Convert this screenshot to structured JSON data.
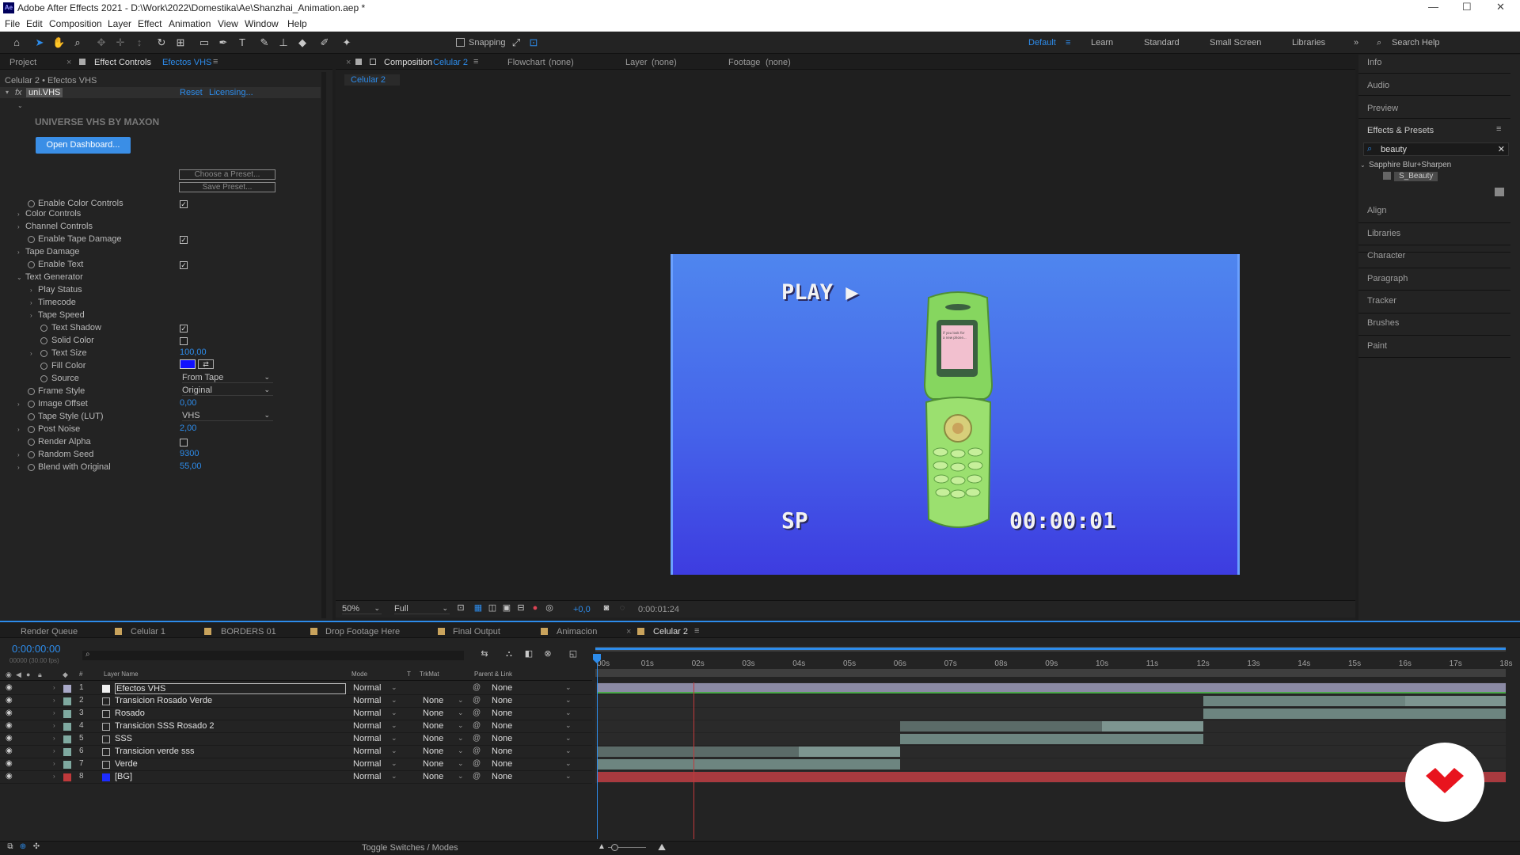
{
  "app": {
    "title": "Adobe After Effects 2021 - D:\\Work\\2022\\Domestika\\Ae\\Shanzhai_Animation.aep *",
    "logo": "Ae",
    "window_controls": [
      "—",
      "☐",
      "✕"
    ]
  },
  "menu": [
    "File",
    "Edit",
    "Composition",
    "Layer",
    "Effect",
    "Animation",
    "View",
    "Window",
    "Help"
  ],
  "toolbar": {
    "snapping_label": "Snapping",
    "workspaces": [
      "Default",
      "Learn",
      "Standard",
      "Small Screen",
      "Libraries"
    ],
    "active_workspace": "Default",
    "search_placeholder": "Search Help"
  },
  "left_panel": {
    "tab_project": "Project",
    "tab_effect_controls": "Effect Controls",
    "tab_effect_controls_target": "Efectos VHS",
    "breadcrumb": "Celular 2 • Efectos VHS",
    "fx_badge": "fx",
    "effect_name": "uni.VHS",
    "reset_label": "Reset",
    "licensing_label": "Licensing...",
    "plugin_title": "UNIVERSE VHS BY MAXON",
    "dashboard_button": "Open Dashboard...",
    "choose_preset": "Choose a Preset...",
    "save_preset": "Save Preset...",
    "properties": [
      {
        "label": "Enable Color Controls",
        "checkbox": true,
        "checked": true
      },
      {
        "label": "Color Controls",
        "group": true
      },
      {
        "label": "Channel Controls",
        "group": true
      },
      {
        "label": "Enable Tape Damage",
        "checkbox": true,
        "checked": true
      },
      {
        "label": "Tape Damage",
        "group": true
      },
      {
        "label": "Enable Text",
        "checkbox": true,
        "checked": true
      },
      {
        "label": "Text Generator",
        "group": true,
        "expanded": true
      },
      {
        "label": "Play Status",
        "group": true,
        "indent": 1
      },
      {
        "label": "Timecode",
        "group": true,
        "indent": 1
      },
      {
        "label": "Tape Speed",
        "group": true,
        "indent": 1
      },
      {
        "label": "Text Shadow",
        "checkbox": true,
        "checked": true,
        "indent": 1
      },
      {
        "label": "Solid Color",
        "checkbox": true,
        "checked": false,
        "indent": 1
      },
      {
        "label": "Text Size",
        "value": "100,00",
        "indent": 1
      },
      {
        "label": "Fill Color",
        "color": "#1010ff",
        "indent": 1
      },
      {
        "label": "Source",
        "dropdown": "From Tape",
        "indent": 1
      },
      {
        "label": "Frame Style",
        "dropdown": "Original"
      },
      {
        "label": "Image Offset",
        "value": "0,00"
      },
      {
        "label": "Tape Style (LUT)",
        "dropdown": "VHS"
      },
      {
        "label": "Post Noise",
        "value": "2,00"
      },
      {
        "label": "Render Alpha",
        "checkbox": true,
        "checked": false
      },
      {
        "label": "Random Seed",
        "value": "9300"
      },
      {
        "label": "Blend with Original",
        "value": "55,00"
      }
    ]
  },
  "viewer": {
    "tab_composition": "Composition",
    "tab_composition_target": "Celular 2",
    "tab_flowchart": "Flowchart",
    "tab_flowchart_target": "(none)",
    "tab_layer": "Layer",
    "tab_layer_target": "(none)",
    "tab_footage": "Footage",
    "tab_footage_target": "(none)",
    "comp_subtab": "Celular 2",
    "overlay_play": "PLAY ▶",
    "overlay_sp": "SP",
    "overlay_timecode": "00:00:01",
    "phone_screen_text": "if you look for a new phone, you'll love something that happens...",
    "zoom": "50%",
    "resolution": "Full",
    "exposure": "+0,0",
    "current_time": "0:00:01:24"
  },
  "right_panel": {
    "items_top": [
      "Info",
      "Audio",
      "Preview"
    ],
    "effects_presets_title": "Effects & Presets",
    "search_value": "beauty",
    "category": "Sapphire Blur+Sharpen",
    "result": "S_Beauty",
    "items_bottom": [
      "Align",
      "Libraries",
      "Character",
      "Paragraph",
      "Tracker",
      "Brushes",
      "Paint"
    ]
  },
  "timeline": {
    "tabs": [
      "Render Queue",
      "Celular 1",
      "BORDERS 01",
      "Drop Footage Here",
      "Final Output",
      "Animacion",
      "Celular 2"
    ],
    "active_tab": "Celular 2",
    "timecode": "0:00:00:00",
    "fps_info": "00000 (30.00 fps)",
    "col_layer_name": "Layer Name",
    "col_mode": "Mode",
    "col_t": "T",
    "col_trkmat": "TrkMat",
    "col_parent": "Parent & Link",
    "ruler_labels": [
      "00s",
      "01s",
      "02s",
      "03s",
      "04s",
      "05s",
      "06s",
      "07s",
      "08s",
      "09s",
      "10s",
      "11s",
      "12s",
      "13s",
      "14s",
      "15s",
      "16s",
      "17s",
      "18s"
    ],
    "playhead_seconds": 0,
    "layers": [
      {
        "num": "1",
        "name": "Efectos VHS",
        "mode": "Normal",
        "trkmat": "",
        "parent": "None",
        "label_color": "#a9a9c8",
        "start": 0,
        "end": 18,
        "bar_color": "#8b8aa4",
        "adjustment": true
      },
      {
        "num": "2",
        "name": "Transicion Rosado Verde",
        "mode": "Normal",
        "trkmat": "None",
        "parent": "None",
        "label_color": "#7fa9a0",
        "start": 12,
        "end": 18,
        "bar_color": "#6d8580",
        "bar2_start": 16,
        "bar2_end": 18
      },
      {
        "num": "3",
        "name": "Rosado",
        "mode": "Normal",
        "trkmat": "None",
        "parent": "None",
        "label_color": "#7fa9a0",
        "start": 12,
        "end": 18,
        "bar_color": "#6d8580"
      },
      {
        "num": "4",
        "name": "Transicion SSS Rosado 2",
        "mode": "Normal",
        "trkmat": "None",
        "parent": "None",
        "label_color": "#7fa9a0",
        "start": 6,
        "end": 12,
        "bar_color": "#5b6b68",
        "bar2_start": 10,
        "bar2_end": 12
      },
      {
        "num": "5",
        "name": "SSS",
        "mode": "Normal",
        "trkmat": "None",
        "parent": "None",
        "label_color": "#7fa9a0",
        "start": 6,
        "end": 12,
        "bar_color": "#6d8580"
      },
      {
        "num": "6",
        "name": "Transicion verde sss",
        "mode": "Normal",
        "trkmat": "None",
        "parent": "None",
        "label_color": "#7fa9a0",
        "start": 0,
        "end": 6,
        "bar_color": "#5b6b68",
        "bar2_start": 4,
        "bar2_end": 6
      },
      {
        "num": "7",
        "name": "Verde",
        "mode": "Normal",
        "trkmat": "None",
        "parent": "None",
        "label_color": "#7fa9a0",
        "start": 0,
        "end": 6,
        "bar_color": "#6d8580"
      },
      {
        "num": "8",
        "name": "[BG]",
        "mode": "Normal",
        "trkmat": "None",
        "parent": "None",
        "label_color": "#c0393b",
        "start": 0,
        "end": 18,
        "bar_color": "#a83a3f",
        "solid": true
      }
    ],
    "toggle_label": "Toggle Switches / Modes"
  },
  "colors": {
    "accent": "#2d8ceb",
    "comp_background": "#3d4fe0",
    "phone_green": "#7fd45c",
    "domestika_red": "#e8141e"
  }
}
